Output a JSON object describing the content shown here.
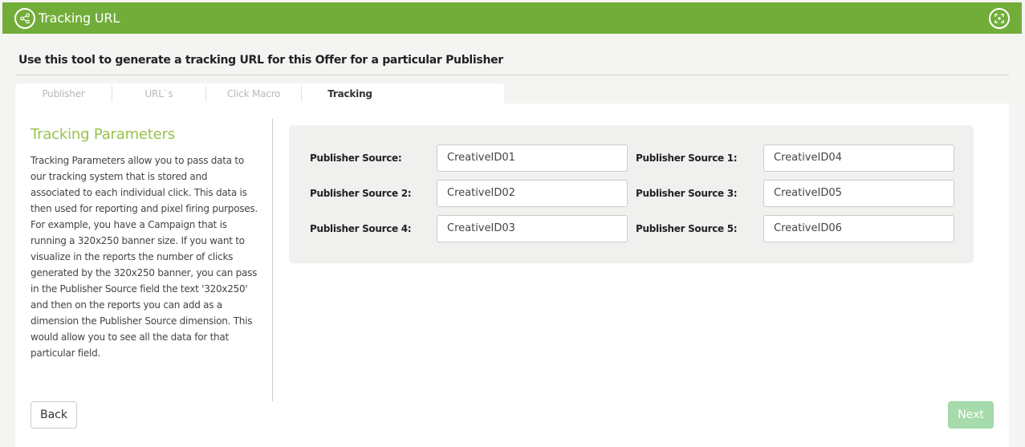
{
  "header": {
    "title": "Tracking URL",
    "left_icon": "share-icon",
    "right_icon": "expand-icon",
    "color": "#72ad3a"
  },
  "description": "Use this tool to generate a tracking URL for this Offer for a particular Publisher",
  "tabs": [
    {
      "label": "Publisher",
      "active": false
    },
    {
      "label": "URL`s",
      "active": false
    },
    {
      "label": "Click Macro",
      "active": false
    },
    {
      "label": "Tracking",
      "active": true
    }
  ],
  "sidebar": {
    "title": "Tracking Parameters",
    "paragraph1": "Tracking Parameters allow you to pass data to our tracking system that is stored and associated to each individual click. This data is then used for reporting and pixel firing purposes.",
    "paragraph2": "For example, you have a Campaign that is running a 320x250 banner size. If you want to visualize in the reports the number of clicks generated by the 320x250 banner, you can pass in the Publisher Source field the text '320x250' and then on the reports you can add as a dimension the Publisher Source dimension. This would allow you to see all the data for that particular field."
  },
  "fields": [
    {
      "label": "Publisher Source:",
      "value": "CreativeID01"
    },
    {
      "label": "Publisher Source 1:",
      "value": "CreativeID04"
    },
    {
      "label": "Publisher Source 2:",
      "value": "CreativeID02"
    },
    {
      "label": "Publisher Source 3:",
      "value": "CreativeID05"
    },
    {
      "label": "Publisher Source 4:",
      "value": "CreativeID03"
    },
    {
      "label": "Publisher Source 5:",
      "value": "CreativeID06"
    }
  ],
  "buttons": {
    "back": "Back",
    "next": "Next"
  },
  "colors": {
    "accent_green": "#72ad3a",
    "title_green": "#99c24a",
    "next_button": "#a6dbab"
  }
}
